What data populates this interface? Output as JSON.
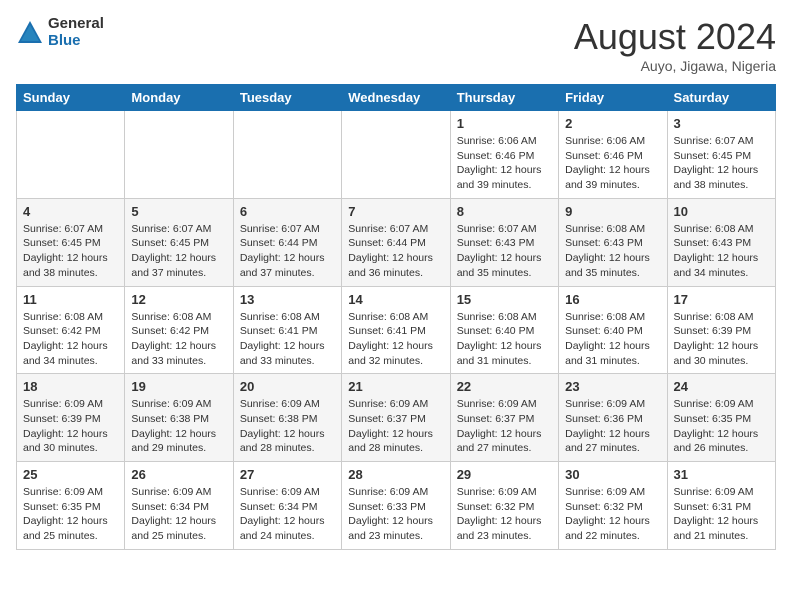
{
  "header": {
    "logo_general": "General",
    "logo_blue": "Blue",
    "month_year": "August 2024",
    "location": "Auyo, Jigawa, Nigeria"
  },
  "days_of_week": [
    "Sunday",
    "Monday",
    "Tuesday",
    "Wednesday",
    "Thursday",
    "Friday",
    "Saturday"
  ],
  "weeks": [
    [
      {
        "day": "",
        "info": ""
      },
      {
        "day": "",
        "info": ""
      },
      {
        "day": "",
        "info": ""
      },
      {
        "day": "",
        "info": ""
      },
      {
        "day": "1",
        "info": "Sunrise: 6:06 AM\nSunset: 6:46 PM\nDaylight: 12 hours\nand 39 minutes."
      },
      {
        "day": "2",
        "info": "Sunrise: 6:06 AM\nSunset: 6:46 PM\nDaylight: 12 hours\nand 39 minutes."
      },
      {
        "day": "3",
        "info": "Sunrise: 6:07 AM\nSunset: 6:45 PM\nDaylight: 12 hours\nand 38 minutes."
      }
    ],
    [
      {
        "day": "4",
        "info": "Sunrise: 6:07 AM\nSunset: 6:45 PM\nDaylight: 12 hours\nand 38 minutes."
      },
      {
        "day": "5",
        "info": "Sunrise: 6:07 AM\nSunset: 6:45 PM\nDaylight: 12 hours\nand 37 minutes."
      },
      {
        "day": "6",
        "info": "Sunrise: 6:07 AM\nSunset: 6:44 PM\nDaylight: 12 hours\nand 37 minutes."
      },
      {
        "day": "7",
        "info": "Sunrise: 6:07 AM\nSunset: 6:44 PM\nDaylight: 12 hours\nand 36 minutes."
      },
      {
        "day": "8",
        "info": "Sunrise: 6:07 AM\nSunset: 6:43 PM\nDaylight: 12 hours\nand 35 minutes."
      },
      {
        "day": "9",
        "info": "Sunrise: 6:08 AM\nSunset: 6:43 PM\nDaylight: 12 hours\nand 35 minutes."
      },
      {
        "day": "10",
        "info": "Sunrise: 6:08 AM\nSunset: 6:43 PM\nDaylight: 12 hours\nand 34 minutes."
      }
    ],
    [
      {
        "day": "11",
        "info": "Sunrise: 6:08 AM\nSunset: 6:42 PM\nDaylight: 12 hours\nand 34 minutes."
      },
      {
        "day": "12",
        "info": "Sunrise: 6:08 AM\nSunset: 6:42 PM\nDaylight: 12 hours\nand 33 minutes."
      },
      {
        "day": "13",
        "info": "Sunrise: 6:08 AM\nSunset: 6:41 PM\nDaylight: 12 hours\nand 33 minutes."
      },
      {
        "day": "14",
        "info": "Sunrise: 6:08 AM\nSunset: 6:41 PM\nDaylight: 12 hours\nand 32 minutes."
      },
      {
        "day": "15",
        "info": "Sunrise: 6:08 AM\nSunset: 6:40 PM\nDaylight: 12 hours\nand 31 minutes."
      },
      {
        "day": "16",
        "info": "Sunrise: 6:08 AM\nSunset: 6:40 PM\nDaylight: 12 hours\nand 31 minutes."
      },
      {
        "day": "17",
        "info": "Sunrise: 6:08 AM\nSunset: 6:39 PM\nDaylight: 12 hours\nand 30 minutes."
      }
    ],
    [
      {
        "day": "18",
        "info": "Sunrise: 6:09 AM\nSunset: 6:39 PM\nDaylight: 12 hours\nand 30 minutes."
      },
      {
        "day": "19",
        "info": "Sunrise: 6:09 AM\nSunset: 6:38 PM\nDaylight: 12 hours\nand 29 minutes."
      },
      {
        "day": "20",
        "info": "Sunrise: 6:09 AM\nSunset: 6:38 PM\nDaylight: 12 hours\nand 28 minutes."
      },
      {
        "day": "21",
        "info": "Sunrise: 6:09 AM\nSunset: 6:37 PM\nDaylight: 12 hours\nand 28 minutes."
      },
      {
        "day": "22",
        "info": "Sunrise: 6:09 AM\nSunset: 6:37 PM\nDaylight: 12 hours\nand 27 minutes."
      },
      {
        "day": "23",
        "info": "Sunrise: 6:09 AM\nSunset: 6:36 PM\nDaylight: 12 hours\nand 27 minutes."
      },
      {
        "day": "24",
        "info": "Sunrise: 6:09 AM\nSunset: 6:35 PM\nDaylight: 12 hours\nand 26 minutes."
      }
    ],
    [
      {
        "day": "25",
        "info": "Sunrise: 6:09 AM\nSunset: 6:35 PM\nDaylight: 12 hours\nand 25 minutes."
      },
      {
        "day": "26",
        "info": "Sunrise: 6:09 AM\nSunset: 6:34 PM\nDaylight: 12 hours\nand 25 minutes."
      },
      {
        "day": "27",
        "info": "Sunrise: 6:09 AM\nSunset: 6:34 PM\nDaylight: 12 hours\nand 24 minutes."
      },
      {
        "day": "28",
        "info": "Sunrise: 6:09 AM\nSunset: 6:33 PM\nDaylight: 12 hours\nand 23 minutes."
      },
      {
        "day": "29",
        "info": "Sunrise: 6:09 AM\nSunset: 6:32 PM\nDaylight: 12 hours\nand 23 minutes."
      },
      {
        "day": "30",
        "info": "Sunrise: 6:09 AM\nSunset: 6:32 PM\nDaylight: 12 hours\nand 22 minutes."
      },
      {
        "day": "31",
        "info": "Sunrise: 6:09 AM\nSunset: 6:31 PM\nDaylight: 12 hours\nand 21 minutes."
      }
    ]
  ]
}
